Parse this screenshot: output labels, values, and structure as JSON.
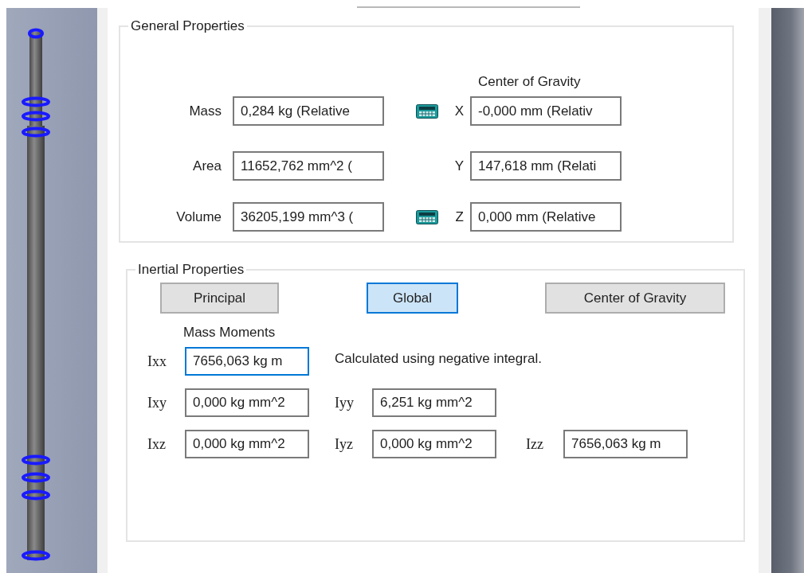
{
  "general": {
    "title": "General Properties",
    "cog_title": "Center of Gravity",
    "rows": [
      {
        "label": "Mass",
        "value": "0,284 kg (Relative",
        "calculator": true,
        "axis": "X",
        "axis_value": "-0,000 mm (Relativ"
      },
      {
        "label": "Area",
        "value": "11652,762 mm^2 (",
        "calculator": false,
        "axis": "Y",
        "axis_value": "147,618 mm (Relati"
      },
      {
        "label": "Volume",
        "value": "36205,199 mm^3 (",
        "calculator": true,
        "axis": "Z",
        "axis_value": "0,000 mm (Relative"
      }
    ]
  },
  "inertial": {
    "title": "Inertial Properties",
    "buttons": [
      {
        "label": "Principal",
        "selected": false
      },
      {
        "label": "Global",
        "selected": true
      },
      {
        "label": "Center of Gravity",
        "selected": false
      }
    ],
    "moments_title": "Mass Moments",
    "note": "Calculated using negative integral.",
    "moments": [
      [
        {
          "label": "Ixx",
          "value": "7656,063 kg m",
          "focused": true
        }
      ],
      [
        {
          "label": "Ixy",
          "value": "0,000 kg mm^2",
          "focused": false
        },
        {
          "label": "Iyy",
          "value": "6,251 kg mm^2",
          "focused": false
        }
      ],
      [
        {
          "label": "Ixz",
          "value": "0,000 kg mm^2",
          "focused": false
        },
        {
          "label": "Iyz",
          "value": "0,000 kg mm^2",
          "focused": false
        },
        {
          "label": "Izz",
          "value": "7656,063 kg m",
          "focused": false
        }
      ]
    ]
  }
}
